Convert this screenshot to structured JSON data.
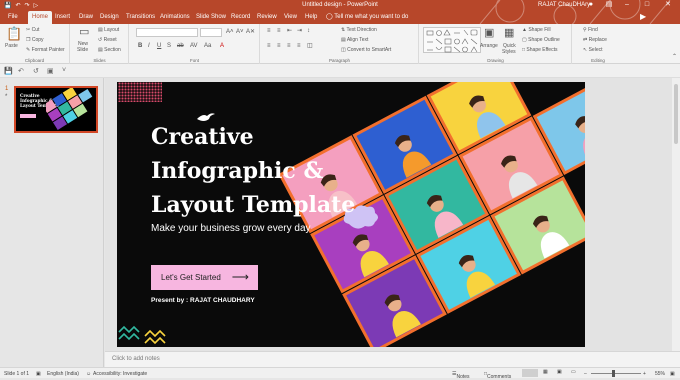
{
  "titlebar": {
    "doc_title": "Untitled design  -  PowerPoint",
    "user": "RAJAT ChauDHAry",
    "qat_icons": [
      "save-icon",
      "undo-icon",
      "redo-icon",
      "present-icon"
    ]
  },
  "tabs": [
    {
      "label": "File"
    },
    {
      "label": "Home"
    },
    {
      "label": "Insert"
    },
    {
      "label": "Draw"
    },
    {
      "label": "Design"
    },
    {
      "label": "Transitions"
    },
    {
      "label": "Animations"
    },
    {
      "label": "Slide Show"
    },
    {
      "label": "Record"
    },
    {
      "label": "Review"
    },
    {
      "label": "View"
    },
    {
      "label": "Help"
    }
  ],
  "tell_me": "Tell me what you want to do",
  "ribbon": {
    "clipboard": {
      "paste": "Paste",
      "cut": "Cut",
      "copy": "Copy",
      "format_painter": "Format Painter",
      "label": "Clipboard"
    },
    "slides": {
      "new_slide": "New",
      "new_slide2": "Slide",
      "layout": "Layout",
      "reset": "Reset",
      "section": "Section",
      "label": "Slides"
    },
    "font": {
      "label": "Font"
    },
    "paragraph": {
      "text_direction": "Text Direction",
      "align_text": "Align Text",
      "convert_smartart": "Convert to SmartArt",
      "label": "Paragraph"
    },
    "drawing": {
      "arrange": "Arrange",
      "quick_styles": "Quick",
      "quick_styles2": "Styles",
      "shape_fill": "Shape Fill",
      "shape_outline": "Shape Outline",
      "shape_effects": "Shape Effects",
      "label": "Drawing"
    },
    "editing": {
      "find": "Find",
      "replace": "Replace",
      "select": "Select",
      "label": "Editing"
    }
  },
  "slide_panel": {
    "number": "1",
    "star": "*"
  },
  "slide": {
    "title_lines": [
      "Creative",
      "Infographic &",
      "Layout Template"
    ],
    "subtitle": "Make your business grow every day",
    "button": "Let's Get Started",
    "presenter": "Present by : RAJAT CHAUDHARY"
  },
  "thumb": {
    "title1": "Creative",
    "title2": "Infographic &",
    "title3": "Layout Template"
  },
  "notes_placeholder": "Click to add notes",
  "status": {
    "slide_of": "Slide 1 of 1",
    "language": "English (India)",
    "accessibility": "Accessibility: Investigate",
    "notes": "Notes",
    "comments": "Comments",
    "zoom": "55%"
  },
  "colors": {
    "accent": "#b7472a",
    "button_pink": "#f7b6e0",
    "tiles": [
      "#f49fbf",
      "#2e5fd1",
      "#f8d33e",
      "#32b8a0",
      "#a83fbf",
      "#7ec7ea",
      "#f6a0a8",
      "#b6e39b",
      "#7c3ab5",
      "#4fd1e5",
      "#f26f2d"
    ]
  }
}
